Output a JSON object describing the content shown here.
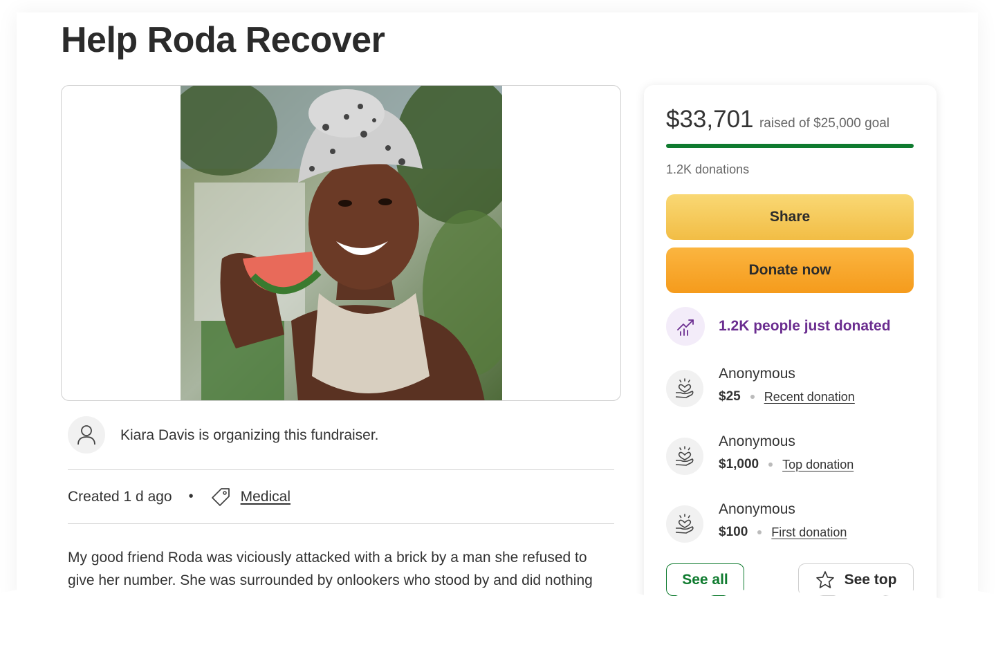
{
  "campaign": {
    "title": "Help Roda Recover",
    "organizer_text": "Kiara Davis is organizing this fundraiser.",
    "created": "Created 1 d ago",
    "category": "Medical",
    "story": "My good friend Roda was viciously attacked with a brick by a man she refused to give her number. She was surrounded by onlookers who stood by and did nothing"
  },
  "sidebar": {
    "raised_amount": "$33,701",
    "raised_goal_text": "raised of $25,000 goal",
    "progress_fraction": 1.0,
    "donation_count": "1.2K donations",
    "share_label": "Share",
    "donate_label": "Donate now",
    "trend_text": "1.2K people just donated",
    "donations": [
      {
        "name": "Anonymous",
        "amount": "$25",
        "label": "Recent donation"
      },
      {
        "name": "Anonymous",
        "amount": "$1,000",
        "label": "Top donation"
      },
      {
        "name": "Anonymous",
        "amount": "$100",
        "label": "First donation"
      }
    ],
    "see_all_label": "See all",
    "see_top_label": "See top"
  },
  "colors": {
    "progress": "#0f7b2f",
    "share_button": "#f2bd45",
    "donate_button": "#f59b1c",
    "trend_text": "#6a2c8f"
  },
  "icons": [
    "person-icon",
    "tag-icon",
    "trend-up-icon",
    "heart-hand-icon",
    "star-icon"
  ]
}
